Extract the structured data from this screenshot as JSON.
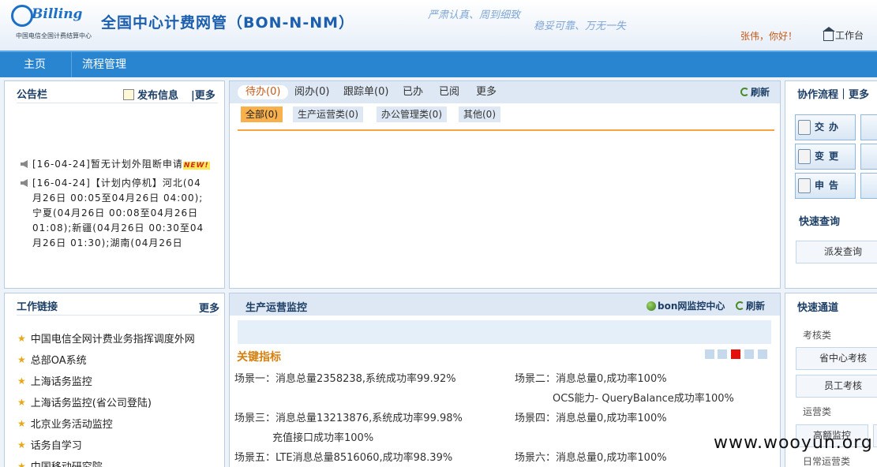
{
  "header": {
    "logo_text": "Billing",
    "logo_subtitle": "中国电信全国计费结算中心",
    "title": "全国中心计费网管（BON-N-NM）",
    "slogan1": "严肃认真、周到细致",
    "slogan2": "稳妥可靠、万无一失",
    "greeting": "张伟，你好！",
    "workspace": "工作台"
  },
  "nav": {
    "home": "主页",
    "flow": "流程管理"
  },
  "bulletin": {
    "title": "公告栏",
    "publish": "发布信息",
    "more": "|更多",
    "items": [
      {
        "text": "[16-04-24]暂无计划外阻断申请",
        "badge": "NEW!"
      },
      {
        "lines": [
          "[16-04-24]【计划内停机】河北(04",
          "月26日 00:05至04月26日 04:00);",
          "宁夏(04月26日 00:08至04月26日",
          "01:08);新疆(04月26日 00:30至04",
          "月26日 01:30);湖南(04月26日"
        ]
      }
    ]
  },
  "todo": {
    "tabs": [
      "待办(0)",
      "阅办(0)",
      "跟踪单(0)",
      "已办",
      "已阅",
      "更多"
    ],
    "refresh": "刷新",
    "subtabs": [
      "全部(0)",
      "生产运营类(0)",
      "办公管理类(0)",
      "其他(0)"
    ]
  },
  "collab": {
    "title": "协作流程｜更多",
    "buttons": [
      "交办",
      "变更",
      "申告"
    ],
    "quick_query_title": "快速查询",
    "dispatch_query": "派发查询"
  },
  "links": {
    "title": "工作链接",
    "more": "更多",
    "items": [
      "中国电信全网计费业务指挥调度外网",
      "总部OA系统",
      "上海话务监控",
      "上海话务监控(省公司登陆)",
      "北京业务活动监控",
      "话务自学习",
      "中国移动研究院"
    ]
  },
  "monitor": {
    "title": "生产运营监控",
    "bon_center": "bon网监控中心",
    "refresh": "刷新",
    "kpi_title": "关键指标",
    "scenes": [
      "场景一：消息总量2358238,系统成功率99.92%",
      "场景二：消息总量0,成功率100%",
      "OCS能力- QueryBalance成功率100%",
      "场景三：消息总量13213876,系统成功率99.98%",
      "场景四：消息总量0,成功率100%",
      "充值接口成功率100%",
      "场景五：LTE消息总量8516060,成功率98.39%",
      "场景六：消息总量0,成功率100%"
    ]
  },
  "quick": {
    "title": "快速通道",
    "section1": "考核类",
    "btn1": "省中心考核",
    "btn2": "员工考核",
    "section2": "运营类",
    "btn3": "高额监控",
    "section3": "日常运营类"
  },
  "watermark": "www.wooyun.org"
}
